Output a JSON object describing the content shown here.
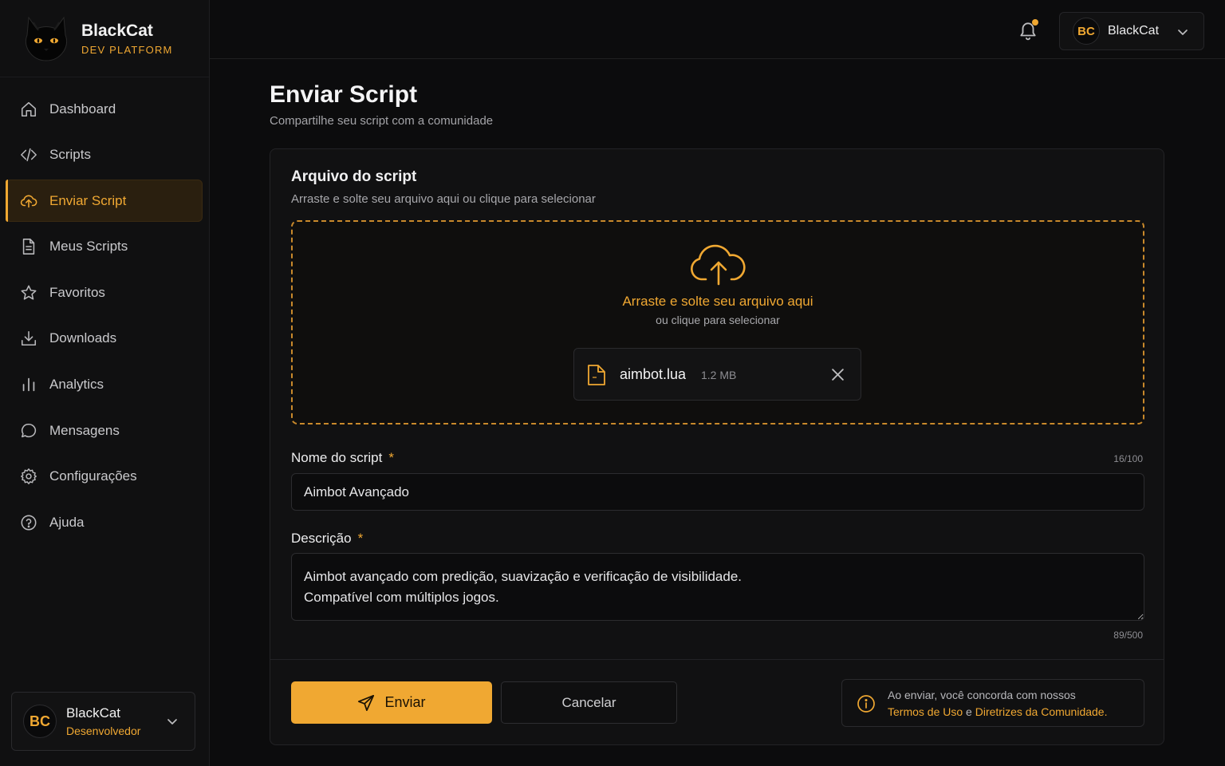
{
  "brand": {
    "name": "BlackCat",
    "subtitle": "DEV PLATFORM"
  },
  "sidebar": {
    "items": [
      {
        "label": "Dashboard",
        "icon": "home-icon"
      },
      {
        "label": "Scripts",
        "icon": "code-icon"
      },
      {
        "label": "Enviar Script",
        "icon": "cloud-upload-icon",
        "active": true
      },
      {
        "label": "Meus Scripts",
        "icon": "file-icon"
      },
      {
        "label": "Favoritos",
        "icon": "star-icon"
      },
      {
        "label": "Downloads",
        "icon": "download-icon"
      },
      {
        "label": "Analytics",
        "icon": "bar-chart-icon"
      },
      {
        "label": "Mensagens",
        "icon": "chat-icon"
      },
      {
        "label": "Configurações",
        "icon": "gear-icon"
      },
      {
        "label": "Ajuda",
        "icon": "help-icon"
      }
    ],
    "user": {
      "initials": "BC",
      "name": "BlackCat",
      "role": "Desenvolvedor"
    }
  },
  "topbar": {
    "user": {
      "initials": "BC",
      "name": "BlackCat"
    },
    "has_notification": true
  },
  "page": {
    "title": "Enviar Script",
    "subtitle": "Compartilhe seu script com a comunidade"
  },
  "upload": {
    "title": "Arquivo do script",
    "subtitle": "Arraste e solte seu arquivo aqui ou clique para selecionar",
    "drop_main": "Arraste e solte seu arquivo aqui",
    "drop_sub": "ou clique para selecionar",
    "file": {
      "name": "aimbot.lua",
      "size": "1.2 MB"
    }
  },
  "form": {
    "name_label": "Nome do script",
    "name_value": "Aimbot Avançado",
    "name_counter": "16/100",
    "desc_label": "Descrição",
    "desc_value": "Aimbot avançado com predição, suavização e verificação de visibilidade.\nCompatível com múltiplos jogos.",
    "desc_counter": "89/500",
    "required_mark": "*"
  },
  "actions": {
    "send_label": "Enviar",
    "cancel_label": "Cancelar"
  },
  "notice": {
    "line1": "Ao enviar, você concorda com nossos",
    "terms": "Termos de Uso",
    "and": " e ",
    "guidelines": "Diretrizes da Comunidade",
    "end": "."
  },
  "colors": {
    "accent": "#f0a832",
    "background": "#0c0c0d",
    "panel": "#111112"
  }
}
